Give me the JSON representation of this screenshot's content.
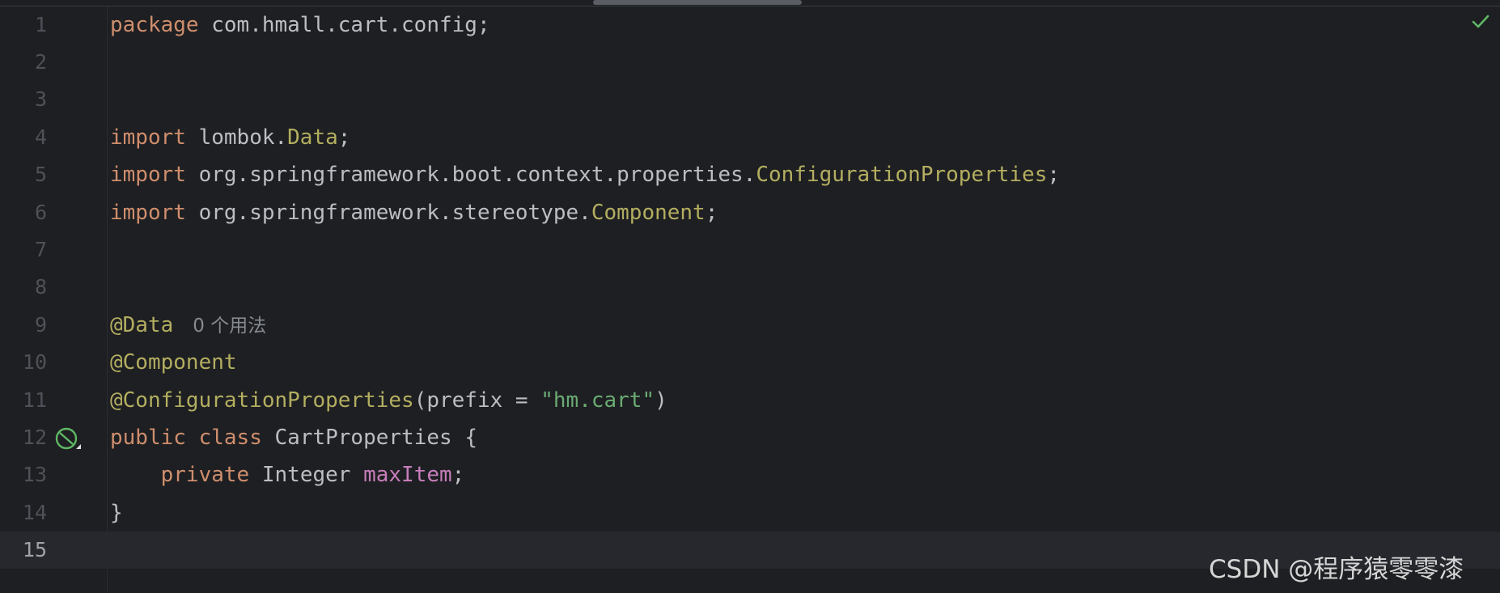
{
  "editor": {
    "file_content": {
      "package_kw": "package",
      "package_name": " com.hmall.cart.config;",
      "import_kw": "import",
      "import1_pkg": " lombok.",
      "import1_cls": "Data",
      "import2_pkg": " org.springframework.boot.context.properties.",
      "import2_cls": "ConfigurationProperties",
      "import3_pkg": " org.springframework.stereotype.",
      "import3_cls": "Component",
      "semicolon": ";",
      "ann_data": "@Data",
      "usage_hint": "0 个用法",
      "ann_component": "@Component",
      "ann_config": "@ConfigurationProperties",
      "config_open": "(prefix = ",
      "config_value": "\"hm.cart\"",
      "config_close": ")",
      "kw_public": "public",
      "kw_class": "class",
      "class_name": " CartProperties {",
      "kw_private": "private",
      "field_type": " Integer ",
      "field_name": "maxItem",
      "field_end": ";",
      "close_brace": "}"
    },
    "line_numbers": [
      "1",
      "2",
      "3",
      "4",
      "5",
      "6",
      "7",
      "8",
      "9",
      "10",
      "11",
      "12",
      "13",
      "14",
      "15"
    ],
    "current_line": "15",
    "icons": {
      "gutter": "spring-bean-icon",
      "status": "inspection-ok-check-icon"
    },
    "colors": {
      "background": "#1e1f22",
      "keyword": "#cf8e6d",
      "annotation": "#b3ae60",
      "string": "#6aab73",
      "field": "#c77dbb",
      "text": "#bcbec4",
      "check": "#5fb865"
    }
  },
  "watermark": "CSDN @程序猿零零漆"
}
